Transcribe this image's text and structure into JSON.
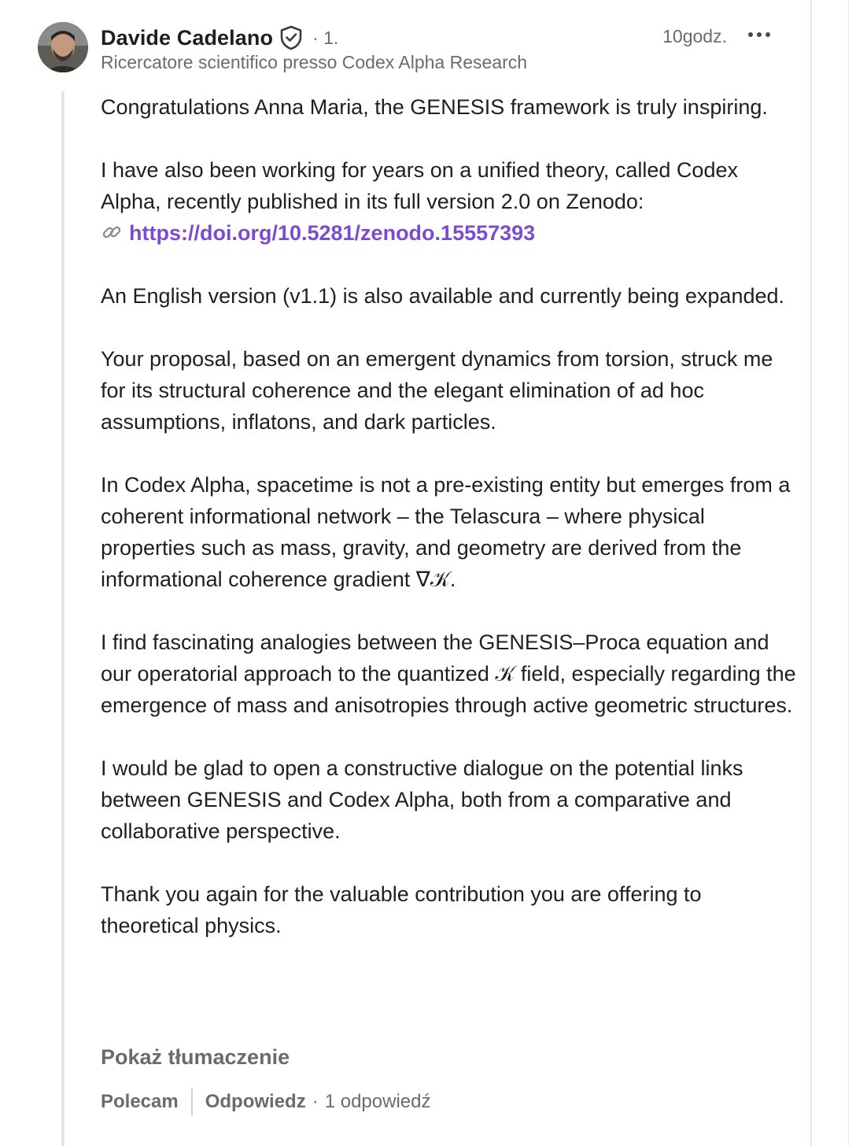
{
  "comment": {
    "author": {
      "name": "Davide Cadelano",
      "degree": "· 1.",
      "headline": "Ricercatore scientifico presso Codex Alpha Research"
    },
    "time": "10godz.",
    "paragraphs": {
      "p1": "Congratulations Anna Maria, the GENESIS framework is truly inspiring.",
      "p2_line1": "I have also been working for years on a unified theory, called Codex Alpha, recently published in its full version 2.0 on Zenodo:",
      "p2_link": "https://doi.org/10.5281/zenodo.15557393",
      "p3": "An English version (v1.1) is also available and currently being expanded.",
      "p4": "Your proposal, based on an emergent dynamics from torsion, struck me for its structural coherence and the elegant elimination of ad hoc assumptions, inflatons, and dark particles.",
      "p5": "In Codex Alpha, spacetime is not a pre-existing entity but emerges from a coherent informational network – the Telascura – where physical properties such as mass, gravity, and geometry are derived from the informational coherence gradient ∇𝒦.",
      "p6": "I find fascinating analogies between the GENESIS–Proca equation and our operatorial approach to the quantized 𝒦 field, especially regarding the emergence of mass and anisotropies through active geometric structures.",
      "p7": "I would be glad to open a constructive dialogue on the potential links between GENESIS and Codex Alpha, both from a comparative and collaborative perspective.",
      "p8": "Thank you again for the valuable contribution you are offering to theoretical physics."
    },
    "translate_label": "Pokaż tłumaczenie",
    "actions": {
      "like": "Polecam",
      "reply": "Odpowiedz",
      "separator": "·",
      "replies_count": "1 odpowiedź"
    }
  },
  "icons": {
    "verified": "shield-check-icon",
    "more": "more-horizontal-icon",
    "link": "link-icon"
  },
  "colors": {
    "link": "#7d4bd0",
    "muted": "#6b6b6b",
    "text": "#1f1f1f",
    "thread_line": "#e4e4e0"
  }
}
